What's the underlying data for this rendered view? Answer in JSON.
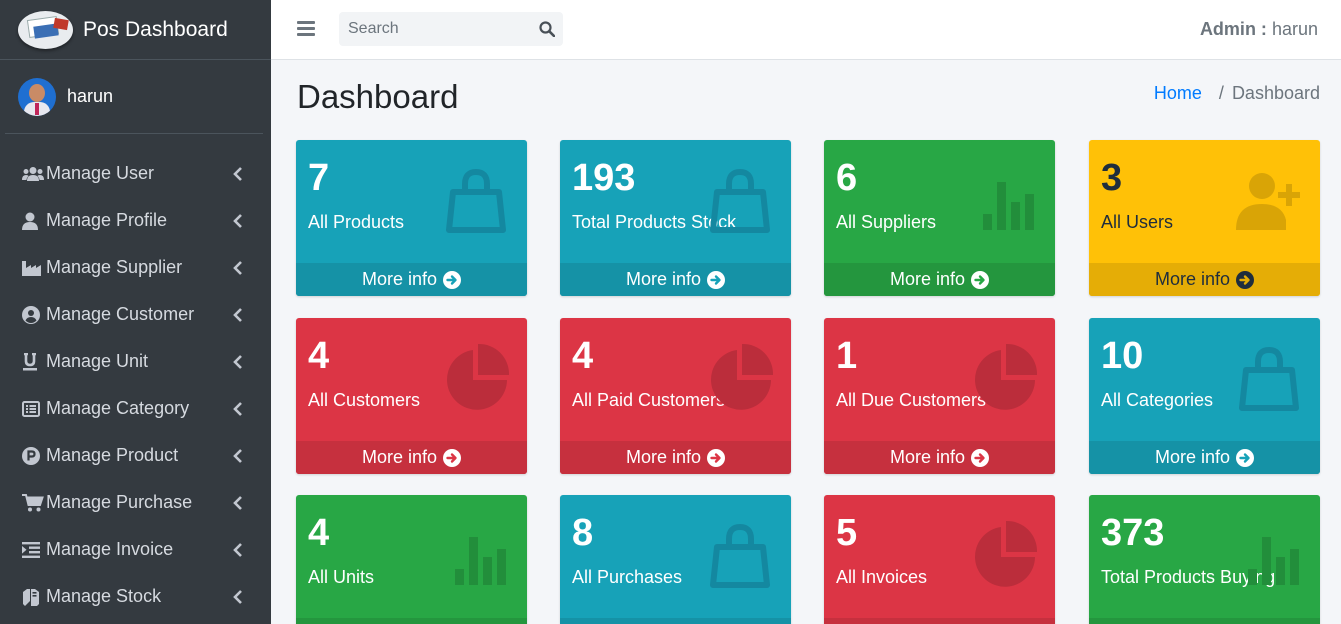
{
  "brand": {
    "title": "Pos Dashboard"
  },
  "user": {
    "name": "harun"
  },
  "sidebar": {
    "items": [
      {
        "label": "Manage User",
        "icon": "users-icon"
      },
      {
        "label": "Manage Profile",
        "icon": "user-icon"
      },
      {
        "label": "Manage Supplier",
        "icon": "industry-icon"
      },
      {
        "label": "Manage Customer",
        "icon": "user-circle-icon"
      },
      {
        "label": "Manage Unit",
        "icon": "underline-icon"
      },
      {
        "label": "Manage Category",
        "icon": "list-alt-icon"
      },
      {
        "label": "Manage Product",
        "icon": "product-p-icon"
      },
      {
        "label": "Manage Purchase",
        "icon": "cart-icon"
      },
      {
        "label": "Manage Invoice",
        "icon": "indent-icon"
      },
      {
        "label": "Manage Stock",
        "icon": "stock-icon"
      }
    ]
  },
  "topbar": {
    "search_placeholder": "Search",
    "admin_label": "Admin :",
    "admin_name": "harun"
  },
  "content": {
    "title": "Dashboard",
    "breadcrumb": {
      "home": "Home",
      "current": "Dashboard"
    }
  },
  "more_info": "More info",
  "boxes": [
    {
      "value": "7",
      "label": "All Products",
      "color": "#17a2b8",
      "icon": "shopping-bag-icon"
    },
    {
      "value": "193",
      "label": "Total Products Stock",
      "color": "#17a2b8",
      "icon": "shopping-bag-icon"
    },
    {
      "value": "6",
      "label": "All Suppliers",
      "color": "#28a745",
      "icon": "bar-chart-icon"
    },
    {
      "value": "3",
      "label": "All Users",
      "color": "#ffc107",
      "icon": "user-plus-icon"
    },
    {
      "value": "4",
      "label": "All Customers",
      "color": "#dc3545",
      "icon": "pie-chart-icon"
    },
    {
      "value": "4",
      "label": "All Paid Customers",
      "color": "#dc3545",
      "icon": "pie-chart-icon"
    },
    {
      "value": "1",
      "label": "All Due Customers",
      "color": "#dc3545",
      "icon": "pie-chart-icon"
    },
    {
      "value": "10",
      "label": "All Categories",
      "color": "#17a2b8",
      "icon": "shopping-bag-icon"
    },
    {
      "value": "4",
      "label": "All Units",
      "color": "#28a745",
      "icon": "bar-chart-icon"
    },
    {
      "value": "8",
      "label": "All Purchases",
      "color": "#17a2b8",
      "icon": "shopping-bag-icon"
    },
    {
      "value": "5",
      "label": "All Invoices",
      "color": "#dc3545",
      "icon": "pie-chart-icon"
    },
    {
      "value": "373",
      "label": "Total Products Buying",
      "color": "#28a745",
      "icon": "bar-chart-icon"
    }
  ]
}
